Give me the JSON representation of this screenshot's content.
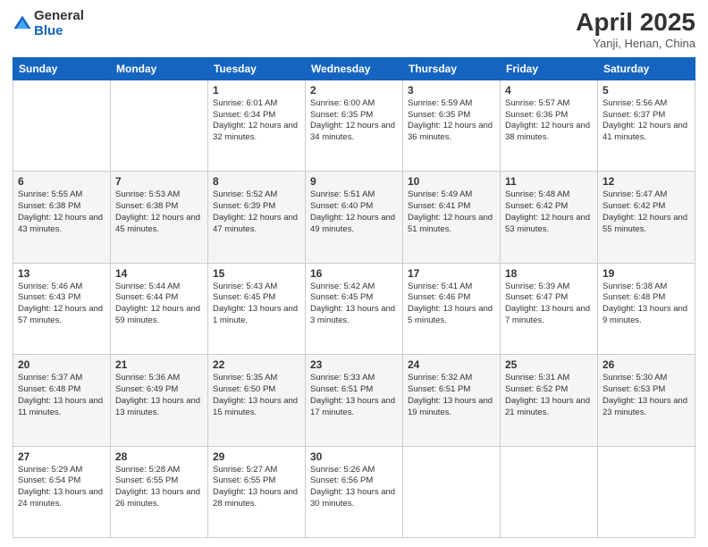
{
  "header": {
    "logo_general": "General",
    "logo_blue": "Blue",
    "main_title": "April 2025",
    "subtitle": "Yanji, Henan, China"
  },
  "days_of_week": [
    "Sunday",
    "Monday",
    "Tuesday",
    "Wednesday",
    "Thursday",
    "Friday",
    "Saturday"
  ],
  "weeks": [
    [
      {
        "day": "",
        "info": ""
      },
      {
        "day": "",
        "info": ""
      },
      {
        "day": "1",
        "info": "Sunrise: 6:01 AM\nSunset: 6:34 PM\nDaylight: 12 hours and 32 minutes."
      },
      {
        "day": "2",
        "info": "Sunrise: 6:00 AM\nSunset: 6:35 PM\nDaylight: 12 hours and 34 minutes."
      },
      {
        "day": "3",
        "info": "Sunrise: 5:59 AM\nSunset: 6:35 PM\nDaylight: 12 hours and 36 minutes."
      },
      {
        "day": "4",
        "info": "Sunrise: 5:57 AM\nSunset: 6:36 PM\nDaylight: 12 hours and 38 minutes."
      },
      {
        "day": "5",
        "info": "Sunrise: 5:56 AM\nSunset: 6:37 PM\nDaylight: 12 hours and 41 minutes."
      }
    ],
    [
      {
        "day": "6",
        "info": "Sunrise: 5:55 AM\nSunset: 6:38 PM\nDaylight: 12 hours and 43 minutes."
      },
      {
        "day": "7",
        "info": "Sunrise: 5:53 AM\nSunset: 6:38 PM\nDaylight: 12 hours and 45 minutes."
      },
      {
        "day": "8",
        "info": "Sunrise: 5:52 AM\nSunset: 6:39 PM\nDaylight: 12 hours and 47 minutes."
      },
      {
        "day": "9",
        "info": "Sunrise: 5:51 AM\nSunset: 6:40 PM\nDaylight: 12 hours and 49 minutes."
      },
      {
        "day": "10",
        "info": "Sunrise: 5:49 AM\nSunset: 6:41 PM\nDaylight: 12 hours and 51 minutes."
      },
      {
        "day": "11",
        "info": "Sunrise: 5:48 AM\nSunset: 6:42 PM\nDaylight: 12 hours and 53 minutes."
      },
      {
        "day": "12",
        "info": "Sunrise: 5:47 AM\nSunset: 6:42 PM\nDaylight: 12 hours and 55 minutes."
      }
    ],
    [
      {
        "day": "13",
        "info": "Sunrise: 5:46 AM\nSunset: 6:43 PM\nDaylight: 12 hours and 57 minutes."
      },
      {
        "day": "14",
        "info": "Sunrise: 5:44 AM\nSunset: 6:44 PM\nDaylight: 12 hours and 59 minutes."
      },
      {
        "day": "15",
        "info": "Sunrise: 5:43 AM\nSunset: 6:45 PM\nDaylight: 13 hours and 1 minute."
      },
      {
        "day": "16",
        "info": "Sunrise: 5:42 AM\nSunset: 6:45 PM\nDaylight: 13 hours and 3 minutes."
      },
      {
        "day": "17",
        "info": "Sunrise: 5:41 AM\nSunset: 6:46 PM\nDaylight: 13 hours and 5 minutes."
      },
      {
        "day": "18",
        "info": "Sunrise: 5:39 AM\nSunset: 6:47 PM\nDaylight: 13 hours and 7 minutes."
      },
      {
        "day": "19",
        "info": "Sunrise: 5:38 AM\nSunset: 6:48 PM\nDaylight: 13 hours and 9 minutes."
      }
    ],
    [
      {
        "day": "20",
        "info": "Sunrise: 5:37 AM\nSunset: 6:48 PM\nDaylight: 13 hours and 11 minutes."
      },
      {
        "day": "21",
        "info": "Sunrise: 5:36 AM\nSunset: 6:49 PM\nDaylight: 13 hours and 13 minutes."
      },
      {
        "day": "22",
        "info": "Sunrise: 5:35 AM\nSunset: 6:50 PM\nDaylight: 13 hours and 15 minutes."
      },
      {
        "day": "23",
        "info": "Sunrise: 5:33 AM\nSunset: 6:51 PM\nDaylight: 13 hours and 17 minutes."
      },
      {
        "day": "24",
        "info": "Sunrise: 5:32 AM\nSunset: 6:51 PM\nDaylight: 13 hours and 19 minutes."
      },
      {
        "day": "25",
        "info": "Sunrise: 5:31 AM\nSunset: 6:52 PM\nDaylight: 13 hours and 21 minutes."
      },
      {
        "day": "26",
        "info": "Sunrise: 5:30 AM\nSunset: 6:53 PM\nDaylight: 13 hours and 23 minutes."
      }
    ],
    [
      {
        "day": "27",
        "info": "Sunrise: 5:29 AM\nSunset: 6:54 PM\nDaylight: 13 hours and 24 minutes."
      },
      {
        "day": "28",
        "info": "Sunrise: 5:28 AM\nSunset: 6:55 PM\nDaylight: 13 hours and 26 minutes."
      },
      {
        "day": "29",
        "info": "Sunrise: 5:27 AM\nSunset: 6:55 PM\nDaylight: 13 hours and 28 minutes."
      },
      {
        "day": "30",
        "info": "Sunrise: 5:26 AM\nSunset: 6:56 PM\nDaylight: 13 hours and 30 minutes."
      },
      {
        "day": "",
        "info": ""
      },
      {
        "day": "",
        "info": ""
      },
      {
        "day": "",
        "info": ""
      }
    ]
  ]
}
